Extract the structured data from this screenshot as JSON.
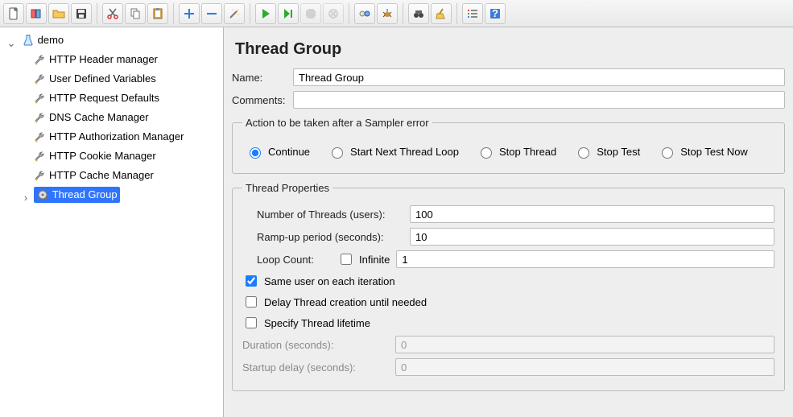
{
  "toolbar": {
    "new_file": "new-file",
    "templates": "templates",
    "open": "open",
    "save": "save",
    "cut": "cut",
    "copy": "copy",
    "paste": "paste",
    "add": "add",
    "remove": "remove",
    "wand": "cleanup",
    "start": "start",
    "start_no_pause": "start-no-pause",
    "stop": "stop",
    "shutdown": "shutdown",
    "toggle": "toggle",
    "clear_gc": "gc",
    "search": "search",
    "clear": "clear",
    "options": "options",
    "help": "help"
  },
  "tree": {
    "root_label": "demo",
    "thread_group_label": "Thread Group",
    "items": [
      {
        "label": "HTTP Header manager"
      },
      {
        "label": "User Defined Variables"
      },
      {
        "label": "HTTP Request Defaults"
      },
      {
        "label": "DNS Cache Manager"
      },
      {
        "label": "HTTP Authorization Manager"
      },
      {
        "label": "HTTP Cookie Manager"
      },
      {
        "label": "HTTP Cache Manager"
      }
    ]
  },
  "panel": {
    "title": "Thread Group",
    "name_label": "Name:",
    "name_value": "Thread Group",
    "comments_label": "Comments:",
    "comments_value": "",
    "error_legend": "Action to be taken after a Sampler error",
    "error_options": {
      "continue": "Continue",
      "start_next": "Start Next Thread Loop",
      "stop_thread": "Stop Thread",
      "stop_test": "Stop Test",
      "stop_test_now": "Stop Test Now"
    },
    "props_legend": "Thread Properties",
    "threads_label": "Number of Threads (users):",
    "threads_value": "100",
    "rampup_label": "Ramp-up period (seconds):",
    "rampup_value": "10",
    "loop_label": "Loop Count:",
    "loop_infinite_label": "Infinite",
    "loop_value": "1",
    "same_user_label": "Same user on each iteration",
    "delay_creation_label": "Delay Thread creation until needed",
    "specify_lifetime_label": "Specify Thread lifetime",
    "duration_label": "Duration (seconds):",
    "duration_value": "0",
    "startup_delay_label": "Startup delay (seconds):",
    "startup_delay_value": "0"
  }
}
